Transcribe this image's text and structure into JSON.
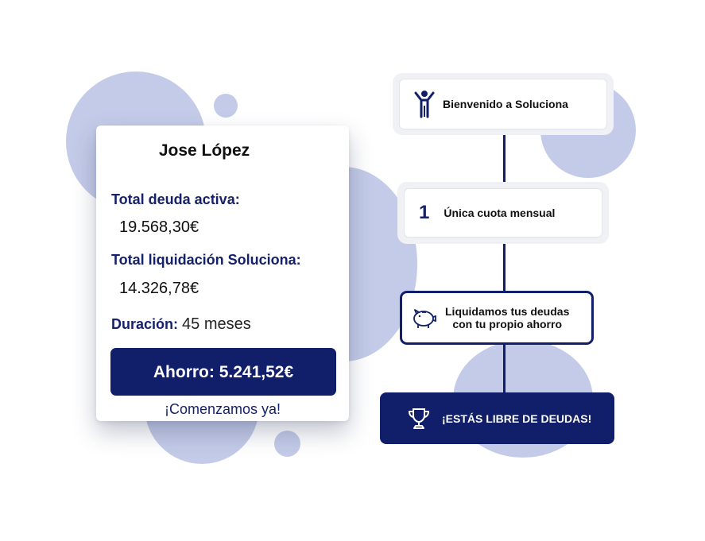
{
  "card": {
    "name": "Jose López",
    "total_debt_label": "Total deuda activa:",
    "total_debt_value": "19.568,30€",
    "liquidation_label": "Total liquidación Soluciona:",
    "liquidation_value": "14.326,78€",
    "duration_label": "Duración:",
    "duration_value": "45 meses",
    "savings_button": "Ahorro: 5.241,52€",
    "start_link": "¡Comenzamos ya!"
  },
  "steps": [
    {
      "icon": "person-arms-up-icon",
      "text": "Bienvenido a Soluciona"
    },
    {
      "icon": "number-one",
      "number": "1",
      "text": "Única cuota mensual"
    },
    {
      "icon": "piggy-bank-icon",
      "text_line1": "Liquidamos tus deudas",
      "text_line2": "con tu propio ahorro"
    },
    {
      "icon": "trophy-icon",
      "text": "¡ESTÁS LIBRE DE DEUDAS!"
    }
  ],
  "colors": {
    "navy": "#111f6a",
    "label_navy": "#15216b",
    "blob": "#c3cbe8",
    "halo": "#f0f1f5"
  }
}
